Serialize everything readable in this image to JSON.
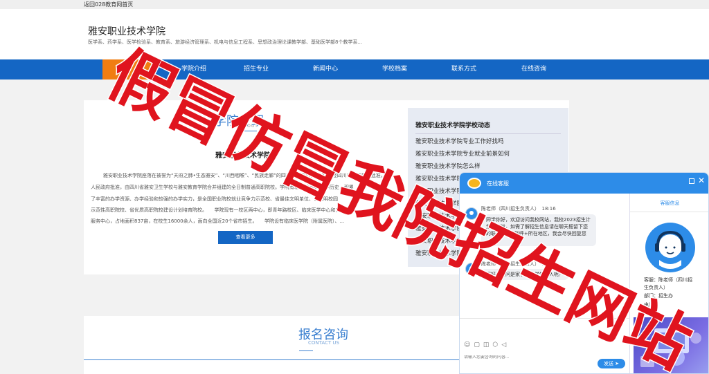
{
  "topbar": {
    "link": "返回028教育网首页"
  },
  "header": {
    "title": "雅安职业技术学院",
    "desc": "医学系、药学系、医学检验系、教育系、旅游经济管理系、机电与信息工程系、思想政治理论课教学部、基础医学部8个教学系..."
  },
  "nav": {
    "items": [
      "学院介绍",
      "招生专业",
      "新闻中心",
      "学校档案",
      "联系方式",
      "在线咨询"
    ]
  },
  "about": {
    "heading": "学院介绍",
    "heading_en": "ABOUT US",
    "school": "雅安职业技术学院",
    "lines": [
      "雅安职业技术学院座落在被誉为“天府之肺•生态雅安”、“川西咽喉”、“民族走廊”的四川省雅安市，2002年经四川省人民政府批准，",
      "人民政府批准，由四川省雅安卫生学校与雅安教育学院合并组建的全日制普通高职院校。学院有着60余年的办学历史，积累",
      "了丰富的办学资源、办学经验和较强的办学实力，是全国职业院校就业竞争力示范校、省最佳文明单位、省文明校园",
      "示范性高职院校、省优质高职院校建设计划培育院校。　　学院现有一校区两中心，即青年路校区、临床医学中心和实训",
      "服务中心，占地面积837亩，在校生16000余人，面向全国近20个省市招生。　　学院设有临床医学院（附属医院）、..."
    ],
    "more": "查看更多"
  },
  "news": {
    "title": "雅安职业技术学院学校动态",
    "items": [
      "雅安职业技术学院专业工作好找吗",
      "雅安职业技术学院专业就业前景如何",
      "雅安职业技术学院怎么样",
      "雅安职业技术学院",
      "雅安职业技术学院",
      "雅安职业技术学院",
      "雅安职业技术学院",
      "雅安职业技术学院",
      "雅安职业技术学院",
      "雅安职业技术学院",
      "雅安职业技术学院"
    ]
  },
  "register": {
    "title": "报名咨询",
    "title_en": "CONTACT US"
  },
  "chat": {
    "title": "在线客服",
    "msg1_meta": "陈老师（四川招生负责人）　18:16",
    "msg1_text": "同学你好，欢迎访问我校网站，我校2023招生计划已下发，如需了解招生信息请在聊天框留下您的联系方式+称呼+所在地区，我会尽快回复您",
    "msg2_meta": "陈老师（四川招生负责人）　18:16",
    "msg2_text": "您好，请问是家长还是学生本人呢？",
    "input_placeholder": "请输入您要咨询的内容...",
    "send": "发送",
    "cs_tab": "客服信息",
    "cs_name": "客服：陈老师（四川招",
    "cs_name2": "生负责人）",
    "cs_dept": "部门：招生办",
    "cs_phone": "电话："
  },
  "watermark": {
    "text": "假冒仿冒我院招生网站",
    "color": "#e0141e"
  }
}
